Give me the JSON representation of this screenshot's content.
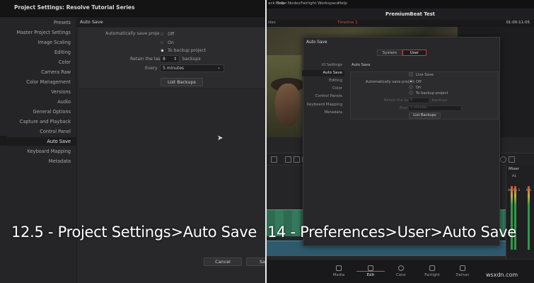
{
  "left_screen": {
    "window_title": "Project Settings:  Resolve Tutorial Series",
    "sidebar": {
      "items": [
        "Presets",
        "Master Project Settings",
        "Image Scaling",
        "Editing",
        "Color",
        "Camera Raw",
        "Color Management",
        "Versions",
        "Audio",
        "General Options",
        "Capture and Playback",
        "Control Panel",
        "Auto Save",
        "Keyboard Mapping",
        "Metadata"
      ],
      "active": "Auto Save"
    },
    "panel_title": "Auto Save",
    "auto_save": {
      "label": "Automatically save project",
      "options": [
        "Off",
        "On",
        "To backup project"
      ],
      "selected": "To backup project",
      "retain_label": "Retain the last",
      "retain_value": "8",
      "retain_unit": "backups",
      "every_label": "Every",
      "every_value": "5 minutes",
      "list_backups": "List Backups"
    },
    "cancel_button": "Cancel",
    "save_button_partial": "Sa"
  },
  "right_screen": {
    "menu": [
      "ack",
      "Help",
      "Color",
      "Nodes",
      "Fairlight",
      "Workspace",
      "Help"
    ],
    "project_name": "PremiumBeat Test",
    "timeline_label": "Timeline 1",
    "timecode": "01:00:11:05",
    "dialog": {
      "title": "Auto Save",
      "tabs": [
        "System",
        "User"
      ],
      "active_tab": "User",
      "sidebar": [
        "UI Settings",
        "Auto Save",
        "Editing",
        "Color",
        "Control Panels",
        "Keyboard Mapping",
        "Metadata"
      ],
      "active_item": "Auto Save",
      "panel_title": "Auto Save",
      "live_save": "Live Save",
      "auto_label": "Automatically save project",
      "options": [
        "Off",
        "On",
        "To backup project"
      ],
      "selected": "Off",
      "retain_label": "Retain the last",
      "retain_value": "8",
      "retain_unit": "backups",
      "every_label": "Every",
      "every_value": "5 minutes",
      "list_backups": "List Backups"
    },
    "mixer_title": "Mixer",
    "mixer_tracks": [
      "A1",
      "Audio 1",
      "Ma"
    ],
    "pages": [
      "Media",
      "Edit",
      "Color",
      "Fairlight",
      "Deliver"
    ],
    "active_page": "Edit",
    "tiny_label": "ideo"
  },
  "captions": {
    "left": "12.5 - Project Settings>Auto Save",
    "right": "14 - Preferences>User>Auto Save"
  },
  "watermark": "wsxdn.com"
}
